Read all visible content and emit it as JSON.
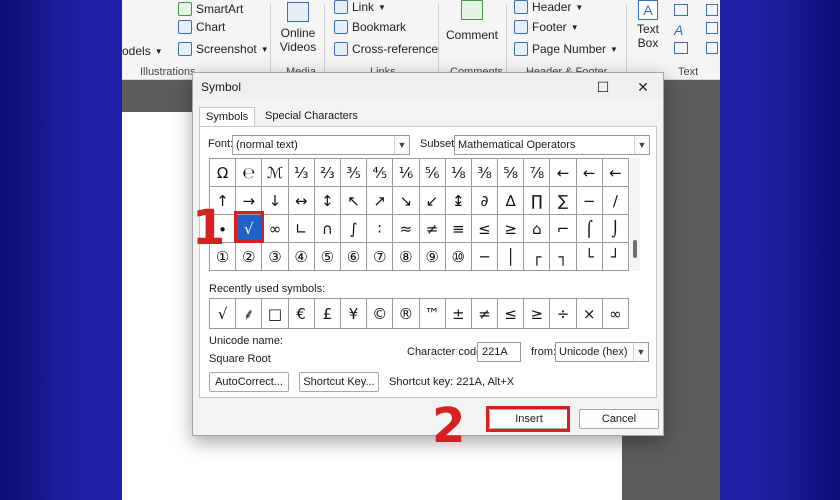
{
  "ribbon": {
    "smartart": "SmartArt",
    "chart": "Chart",
    "models": "odels",
    "screenshot": "Screenshot",
    "illustrations": "Illustrations",
    "online_videos_1": "Online",
    "online_videos_2": "Videos",
    "media": "Media",
    "link": "Link",
    "bookmark": "Bookmark",
    "cross_reference": "Cross-reference",
    "links": "Links",
    "comment": "Comment",
    "comments": "Comments",
    "header": "Header",
    "footer": "Footer",
    "page_number": "Page Number",
    "header_footer": "Header & Footer",
    "text_box_1": "Text",
    "text_box_2": "Box",
    "text_group": "Text"
  },
  "dialog": {
    "title": "Symbol",
    "tabs": [
      "Symbols",
      "Special Characters"
    ],
    "font_label": "Font:",
    "font_value": "(normal text)",
    "subset_label": "Subset:",
    "subset_value": "Mathematical Operators",
    "grid": [
      [
        "Ω",
        "℮",
        "ℳ",
        "⅓",
        "⅔",
        "⅗",
        "⅘",
        "⅙",
        "⅚",
        "⅛",
        "⅜",
        "⅝",
        "⅞",
        "←",
        "←",
        "←"
      ],
      [
        "↑",
        "→",
        "↓",
        "↔",
        "↕",
        "↖",
        "↗",
        "↘",
        "↙",
        "↨",
        "∂",
        "∆",
        "∏",
        "∑",
        "−",
        "∕"
      ],
      [
        "∙",
        "√",
        "∞",
        "∟",
        "∩",
        "∫",
        "∶",
        "≈",
        "≠",
        "≡",
        "≤",
        "≥",
        "⌂",
        "⌐",
        "⌠",
        "⌡"
      ],
      [
        "①",
        "②",
        "③",
        "④",
        "⑤",
        "⑥",
        "⑦",
        "⑧",
        "⑨",
        "⑩",
        "─",
        "│",
        "┌",
        "┐",
        "└",
        "┘"
      ]
    ],
    "selected_symbol": "√",
    "recent_label": "Recently used symbols:",
    "recent": [
      "√",
      "⸙",
      "□",
      "€",
      "£",
      "¥",
      "©",
      "®",
      "™",
      "±",
      "≠",
      "≤",
      "≥",
      "÷",
      "×",
      "∞"
    ],
    "unicode_name_label": "Unicode name:",
    "unicode_name": "Square Root",
    "char_code_label": "Character code:",
    "char_code": "221A",
    "from_label": "from:",
    "from_value": "Unicode (hex)",
    "autocorrect": "AutoCorrect...",
    "shortcut_key_btn": "Shortcut Key...",
    "shortcut_text": "Shortcut key: 221A, Alt+X",
    "insert": "Insert",
    "cancel": "Cancel"
  },
  "annotations": {
    "step1": "1",
    "step2": "2"
  },
  "colors": {
    "accent_red": "#d72020",
    "selection_blue": "#1f63c9",
    "background_blue": "#1f25b4"
  }
}
